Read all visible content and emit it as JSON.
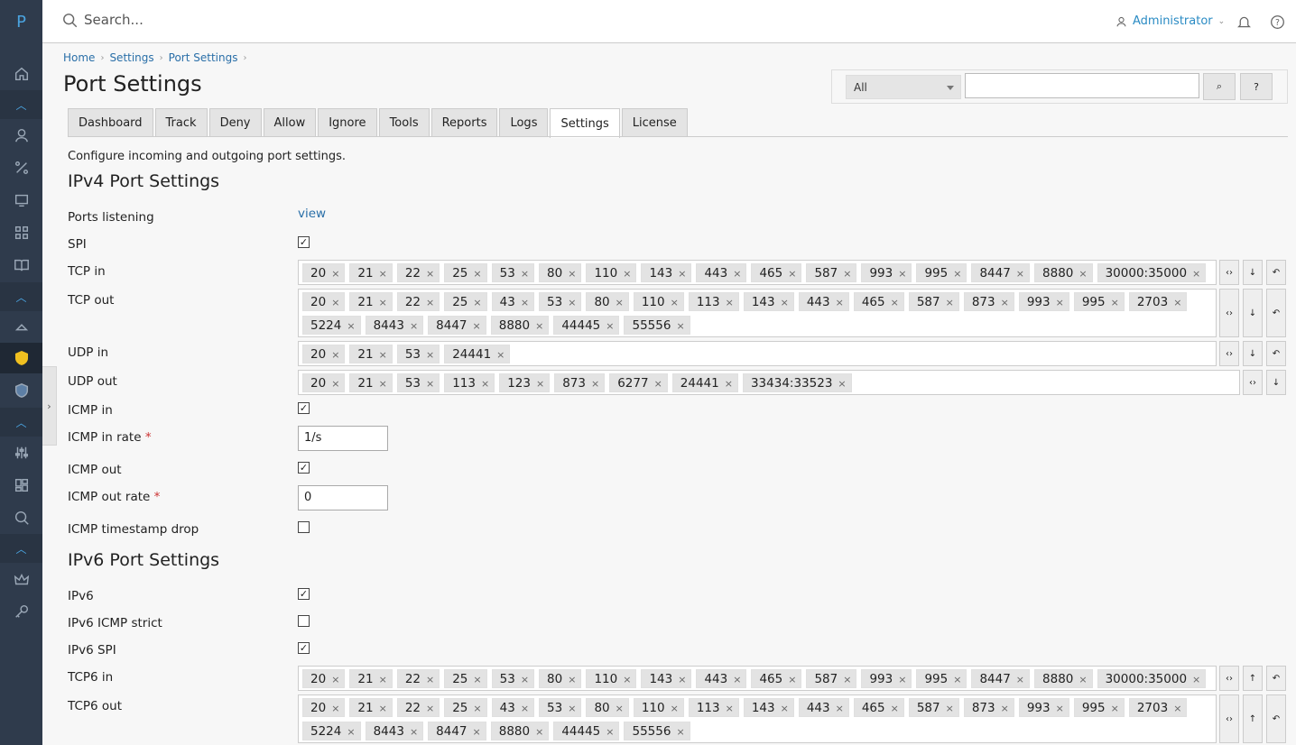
{
  "app": {
    "logo": "P"
  },
  "search": {
    "placeholder": "Search..."
  },
  "user": {
    "name": "Administrator"
  },
  "breadcrumb": [
    "Home",
    "Settings",
    "Port Settings"
  ],
  "page": {
    "title": "Port Settings",
    "description": "Configure incoming and outgoing port settings."
  },
  "filter": {
    "select_value": "All",
    "search_label": "⌕",
    "help_label": "?"
  },
  "tabs": [
    "Dashboard",
    "Track",
    "Deny",
    "Allow",
    "Ignore",
    "Tools",
    "Reports",
    "Logs",
    "Settings",
    "License"
  ],
  "active_tab": "Settings",
  "ipv4": {
    "title": "IPv4 Port Settings",
    "ports_listening": {
      "label": "Ports listening",
      "link": "view"
    },
    "spi": {
      "label": "SPI",
      "checked": true
    },
    "tcp_in": {
      "label": "TCP in",
      "tags": [
        "20",
        "21",
        "22",
        "25",
        "53",
        "80",
        "110",
        "143",
        "443",
        "465",
        "587",
        "993",
        "995",
        "8447",
        "8880",
        "30000:35000"
      ]
    },
    "tcp_out": {
      "label": "TCP out",
      "tags": [
        "20",
        "21",
        "22",
        "25",
        "43",
        "53",
        "80",
        "110",
        "113",
        "143",
        "443",
        "465",
        "587",
        "873",
        "993",
        "995",
        "2703",
        "5224",
        "8443",
        "8447",
        "8880",
        "44445",
        "55556"
      ]
    },
    "udp_in": {
      "label": "UDP in",
      "tags": [
        "20",
        "21",
        "53",
        "24441"
      ]
    },
    "udp_out": {
      "label": "UDP out",
      "tags": [
        "20",
        "21",
        "53",
        "113",
        "123",
        "873",
        "6277",
        "24441",
        "33434:33523"
      ]
    },
    "icmp_in": {
      "label": "ICMP in",
      "checked": true
    },
    "icmp_in_rate": {
      "label": "ICMP in rate",
      "value": "1/s"
    },
    "icmp_out": {
      "label": "ICMP out",
      "checked": true
    },
    "icmp_out_rate": {
      "label": "ICMP out rate",
      "value": "0"
    },
    "icmp_timestamp_drop": {
      "label": "ICMP timestamp drop",
      "checked": false
    }
  },
  "ipv6": {
    "title": "IPv6 Port Settings",
    "ipv6": {
      "label": "IPv6",
      "checked": true
    },
    "icmp_strict": {
      "label": "IPv6 ICMP strict",
      "checked": false
    },
    "spi": {
      "label": "IPv6 SPI",
      "checked": true
    },
    "tcp6_in": {
      "label": "TCP6 in",
      "tags": [
        "20",
        "21",
        "22",
        "25",
        "53",
        "80",
        "110",
        "143",
        "443",
        "465",
        "587",
        "993",
        "995",
        "8447",
        "8880",
        "30000:35000"
      ]
    },
    "tcp6_out": {
      "label": "TCP6 out",
      "tags": [
        "20",
        "21",
        "22",
        "25",
        "43",
        "53",
        "80",
        "110",
        "113",
        "143",
        "443",
        "465",
        "587",
        "873",
        "993",
        "995",
        "2703",
        "5224",
        "8443",
        "8447",
        "8880",
        "44445",
        "55556"
      ]
    }
  },
  "required_mark": "*",
  "tag_remove": "×",
  "buttons": {
    "expand": "‹›",
    "down": "↓",
    "up": "↑",
    "reset": "↶"
  }
}
